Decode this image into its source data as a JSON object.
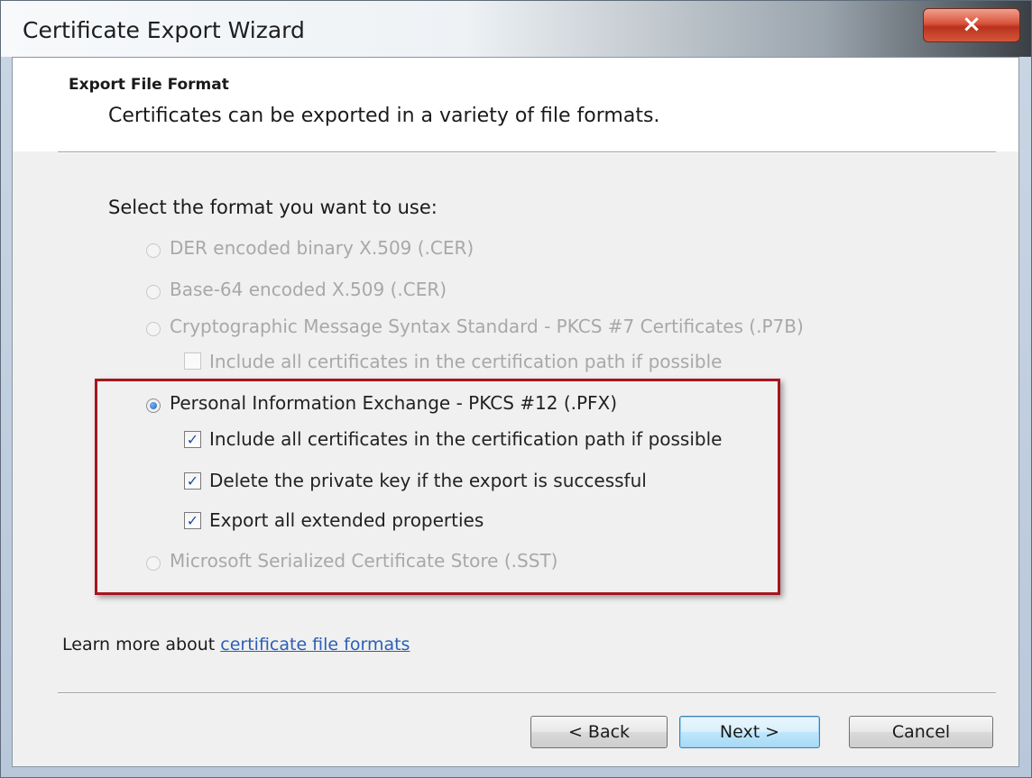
{
  "window": {
    "title": "Certificate Export Wizard",
    "close_glyph": "×"
  },
  "header": {
    "title": "Export File Format",
    "subtitle": "Certificates can be exported in a variety of file formats."
  },
  "body": {
    "prompt": "Select the format you want to use:",
    "options": [
      {
        "label": "DER encoded binary X.509 (.CER)",
        "enabled": false,
        "selected": false
      },
      {
        "label": "Base-64 encoded X.509 (.CER)",
        "enabled": false,
        "selected": false
      },
      {
        "label": "Cryptographic Message Syntax Standard - PKCS #7 Certificates (.P7B)",
        "enabled": false,
        "selected": false
      },
      {
        "label": "Personal Information Exchange - PKCS #12 (.PFX)",
        "enabled": true,
        "selected": true
      },
      {
        "label": "Microsoft Serialized Certificate Store (.SST)",
        "enabled": false,
        "selected": false
      }
    ],
    "p7b_checkbox": {
      "label": "Include all certificates in the certification path if possible",
      "checked": false,
      "enabled": false
    },
    "pfx_checkboxes": [
      {
        "label": "Include all certificates in the certification path if possible",
        "checked": true
      },
      {
        "label": "Delete the private key if the export is successful",
        "checked": true
      },
      {
        "label": "Export all extended properties",
        "checked": true
      }
    ],
    "check_glyph": "✓"
  },
  "footer": {
    "learn_prefix": "Learn more about ",
    "learn_link": "certificate file formats",
    "back_label": "< Back",
    "next_label": "Next >",
    "cancel_label": "Cancel"
  },
  "colors": {
    "highlight_border": "#a6151f",
    "link": "#2a5fb5",
    "close_button": "#c9432c"
  }
}
